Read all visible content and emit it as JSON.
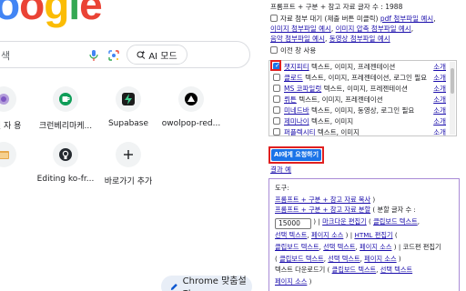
{
  "ntp": {
    "logo_letters": [
      "o",
      "o",
      "g",
      "l",
      "e",
      ""
    ],
    "search_text": "색",
    "ai_mode_label": "AI 모드",
    "shortcuts": [
      {
        "label": "사전 자 용",
        "icon": "bubble-icon"
      },
      {
        "label": "크런베리마케...",
        "icon": "green-cup-icon"
      },
      {
        "label": "Supabase",
        "icon": "supabase-bolt-icon"
      },
      {
        "label": "owolpop-red...",
        "icon": "triangle-icon"
      },
      {
        "label": "",
        "icon": "folder-icon"
      },
      {
        "label": "Editing ko-fr...",
        "icon": "github-icon"
      },
      {
        "label": "바로가기 추가",
        "icon": "plus-icon"
      }
    ],
    "customize_label": "Chrome 맞춤설정"
  },
  "panel": {
    "char_count": "프롬프트 + 구분 + 참고 자료 글자 수 : 1988",
    "attach_wait_label": "자료 첨부 대기 (제출 버튼 미클릭)",
    "pdf_example": "pdf 첨부파일 예시",
    "image_example": "이미지 첨부파일 예시",
    "zip_example": "이미지 압축 첨부파일 예시",
    "audio_example": "음악 첨부파일 예시",
    "video_example": "동영상 첨부파일 예시",
    "prev_use_label": "이전 창 사용",
    "more_label": "소개",
    "ai_list": [
      {
        "name": "챗지피티",
        "desc": "텍스트, 이미지, 프레젠테이션",
        "checked": true
      },
      {
        "name": "클로드",
        "desc": "텍스트, 이미지, 프레젠테이션, 로그인 필요",
        "checked": false
      },
      {
        "name": "MS 코파일럿",
        "desc": "텍스트, 이미지, 프레젠테이션",
        "checked": false
      },
      {
        "name": "뤼튼",
        "desc": "텍스트, 이미지, 프레젠테이션",
        "checked": false
      },
      {
        "name": "미네드바",
        "desc": "텍스트, 이미지, 동영상, 로그인 필요",
        "checked": false
      },
      {
        "name": "제미나이",
        "desc": "텍스트, 이미지",
        "checked": false
      },
      {
        "name": "퍼플렉시티",
        "desc": "텍스트, 이미지",
        "checked": false
      }
    ],
    "ask_button": "AI에게 요청하기",
    "result_example": "결과 예",
    "tools": {
      "title": "도구:",
      "copy_prompt": "프롬프트 + 구분 + 참고 자료 복사",
      "split_prompt": "프롬프트 + 구분 + 참고 자료 분할",
      "split_count_label": "( 분할 글자 수 :",
      "split_count_value": "15000",
      "markdown_editor": "마크다운 편집기",
      "clipboard_text": "클립보드 텍스트",
      "selected_text": "선택 텍스트",
      "page_source": "페이지 소스",
      "html_editor": "HTML 편집기",
      "code_editor": "코드편 편집기",
      "text_download": "텍스트 다운로드기",
      "l1_pre": ")",
      "l2_pre": ") ( 분할 글자 수 :",
      "l3_pre": ")",
      "l3_sep": "|",
      "l3_open": "(",
      "l3_comma": ",",
      "l4_comma": ",",
      "l4_close": ")",
      "l4_sep": "|",
      "l4_open": "(",
      "l5_comma": ",",
      "l5_close": ")",
      "l5_sep": "|",
      "l5_open": "(",
      "l6_comma": ",",
      "l6_close": ")",
      "l6_open": "(",
      "l7_comma": ",",
      "l7_close": ")"
    }
  },
  "colors": {
    "link": "#1a0dab",
    "button_blue": "#1a73e8",
    "highlight_red": "#e02020",
    "tools_border": "#a98bd6"
  }
}
